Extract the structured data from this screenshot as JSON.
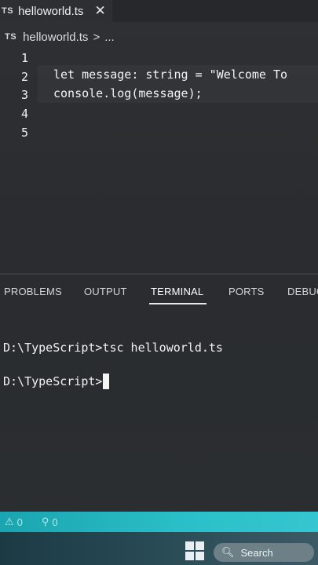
{
  "editor_tab": {
    "badge": "TS",
    "filename": "helloworld.ts",
    "close_glyph": "✕"
  },
  "breadcrumb": {
    "badge": "TS",
    "filename": "helloworld.ts",
    "separator": ">",
    "more": "..."
  },
  "editor": {
    "line_numbers": [
      "1",
      "2",
      "3",
      "4",
      "5"
    ],
    "lines": [
      "",
      "let message: string = \"Welcome To",
      "console.log(message);",
      "",
      ""
    ]
  },
  "panel": {
    "tabs": [
      "PROBLEMS",
      "OUTPUT",
      "TERMINAL",
      "PORTS",
      "DEBUG"
    ],
    "active_tab": "TERMINAL"
  },
  "terminal": {
    "lines": [
      "D:\\TypeScript>tsc helloworld.ts",
      "D:\\TypeScript>"
    ]
  },
  "statusbar": {
    "errors": "0",
    "warnings": "0",
    "color": "#2bc0c9"
  },
  "taskbar": {
    "search_label": "Search"
  }
}
